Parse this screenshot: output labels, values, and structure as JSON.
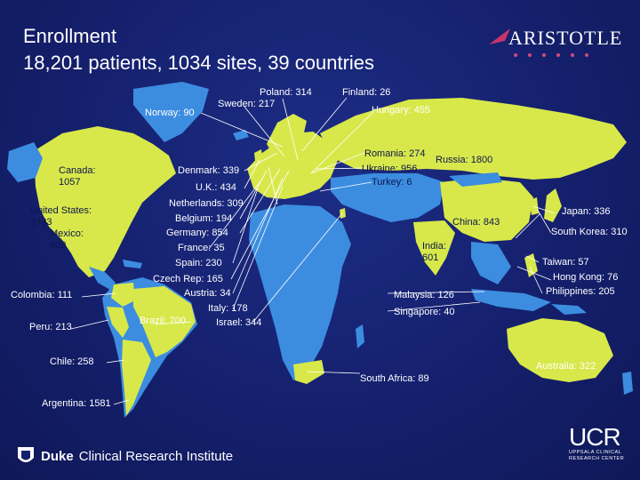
{
  "title": {
    "line1": "Enrollment",
    "line2": "18,201 patients, 1034 sites, 39 countries"
  },
  "logos": {
    "aristotle": "ARISTOTLE",
    "duke_name": "Duke",
    "duke_rest": "Clinical Research Institute",
    "ucr": "UCR",
    "ucr_sub1": "UPPSALA CLINICAL",
    "ucr_sub2": "RESEARCH CENTER"
  },
  "colors": {
    "ocean": "#1a2a80",
    "land_enrolled": "#d8e84a",
    "land_other": "#3c8de0",
    "leader_line": "#ffffff"
  },
  "countries": {
    "norway": "Norway: 90",
    "sweden": "Sweden: 217",
    "poland": "Poland: 314",
    "finland": "Finland: 26",
    "hungary": "Hungary: 455",
    "canada": "Canada:\n1057",
    "united_states": "United States:\n3433",
    "mexico": "Mexico:\n609",
    "colombia": "Colombia: 111",
    "peru": "Peru: 213",
    "chile": "Chile: 258",
    "argentina": "Argentina: 1581",
    "brazil": "Brazil: 700",
    "denmark": "Denmark: 339",
    "uk": "U.K.: 434",
    "netherlands": "Netherlands: 309",
    "belgium": "Belgium: 194",
    "germany": "Germany: 854",
    "france": "France: 35",
    "spain": "Spain: 230",
    "czech": "Czech Rep: 165",
    "austria": "Austria: 34",
    "italy": "Italy: 178",
    "israel": "Israel: 344",
    "romania": "Romania: 274",
    "ukraine": "Ukraine: 956",
    "turkey": "Turkey: 6",
    "russia": "Russia: 1800",
    "china": "China: 843",
    "india": "India:\n601",
    "japan": "Japan: 336",
    "south_korea": "South Korea: 310",
    "taiwan": "Taiwan: 57",
    "hong_kong": "Hong Kong: 76",
    "philippines": "Philippines: 205",
    "malaysia": "Malaysia: 126",
    "singapore": "Singapore: 40",
    "south_africa": "South Africa: 89",
    "australia": "Australia: 322"
  }
}
